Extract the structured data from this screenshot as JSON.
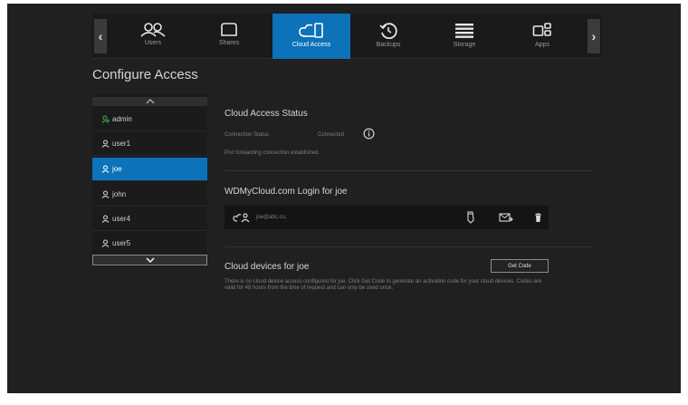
{
  "nav": {
    "tabs": [
      {
        "label": "Users",
        "icon": "users-icon"
      },
      {
        "label": "Shares",
        "icon": "shares-icon"
      },
      {
        "label": "Cloud Access",
        "icon": "cloud-access-icon"
      },
      {
        "label": "Backups",
        "icon": "backups-icon"
      },
      {
        "label": "Storage",
        "icon": "storage-icon"
      },
      {
        "label": "Apps",
        "icon": "apps-icon"
      }
    ],
    "active": "Cloud Access",
    "left_arrow": "‹",
    "right_arrow": "›"
  },
  "page_title": "Configure Access",
  "users": [
    {
      "name": "admin",
      "icon": "admin-user-icon"
    },
    {
      "name": "user1",
      "icon": "user-icon"
    },
    {
      "name": "joe",
      "icon": "user-icon"
    },
    {
      "name": "john",
      "icon": "user-icon"
    },
    {
      "name": "user4",
      "icon": "user-icon"
    },
    {
      "name": "user5",
      "icon": "user-icon"
    }
  ],
  "selected_user": "joe",
  "cloud_status": {
    "title": "Cloud Access Status",
    "connection_label": "Connection Status",
    "connection_value": "Connected",
    "port_message": "Port forwarding connection established."
  },
  "login": {
    "title": "WDMyCloud.com Login for joe",
    "email": "joe@abc.co,"
  },
  "cloud_devices": {
    "title": "Cloud devices for joe",
    "get_code_label": "Get Code",
    "message": "There is no cloud device access configured for joe. Click Get Code to generate an activation code for your cloud devices. Codes are valid for 48 hours from the time of request and can only be used once."
  },
  "colors": {
    "accent": "#0c72b9",
    "background": "#202021",
    "admin_icon": "#3aa84a"
  }
}
